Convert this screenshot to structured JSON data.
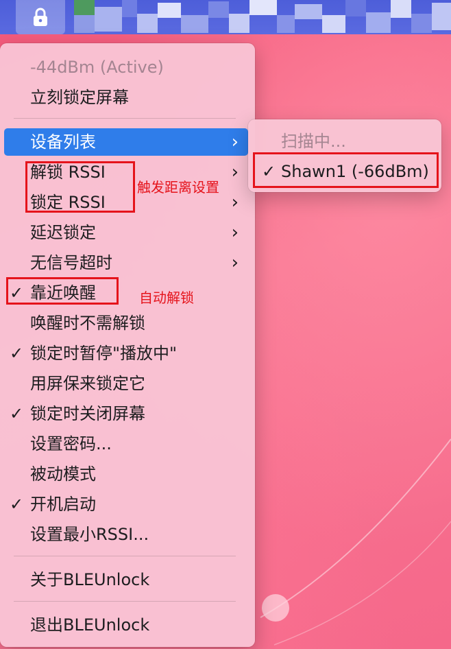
{
  "menubar": {
    "lock_icon": "lock-icon"
  },
  "menu": {
    "items": [
      {
        "label": "-44dBm (Active)",
        "disabled": true
      },
      {
        "label": "立刻锁定屏幕"
      },
      {
        "label": "设备列表",
        "submenu": true,
        "selected": true
      },
      {
        "label": "解锁 RSSI",
        "submenu": true
      },
      {
        "label": "锁定 RSSI",
        "submenu": true
      },
      {
        "label": "延迟锁定",
        "submenu": true
      },
      {
        "label": "无信号超时",
        "submenu": true
      },
      {
        "label": "靠近唤醒",
        "checked": true
      },
      {
        "label": "唤醒时不需解锁"
      },
      {
        "label": "锁定时暂停\"播放中\"",
        "checked": true
      },
      {
        "label": "用屏保来锁定它"
      },
      {
        "label": "锁定时关闭屏幕",
        "checked": true
      },
      {
        "label": "设置密码..."
      },
      {
        "label": "被动模式"
      },
      {
        "label": "开机启动",
        "checked": true
      },
      {
        "label": "设置最小RSSI..."
      },
      {
        "label": "关于BLEUnlock"
      },
      {
        "label": "退出BLEUnlock"
      }
    ],
    "check_glyph": "✓",
    "arrow_glyph": "›"
  },
  "submenu": {
    "items": [
      {
        "label": "扫描中...",
        "disabled": true
      },
      {
        "label": "Shawn1 (-66dBm)",
        "checked": true
      }
    ]
  },
  "annotations": {
    "trigger_distance": "触发距离设置",
    "auto_unlock": "自动解锁"
  },
  "colors": {
    "menubar": "#4d5ed9",
    "menu_bg": "#f9c4d4",
    "selection": "#2f7dea",
    "annotation": "#e5131b",
    "wallpaper": "#f66f8c"
  }
}
